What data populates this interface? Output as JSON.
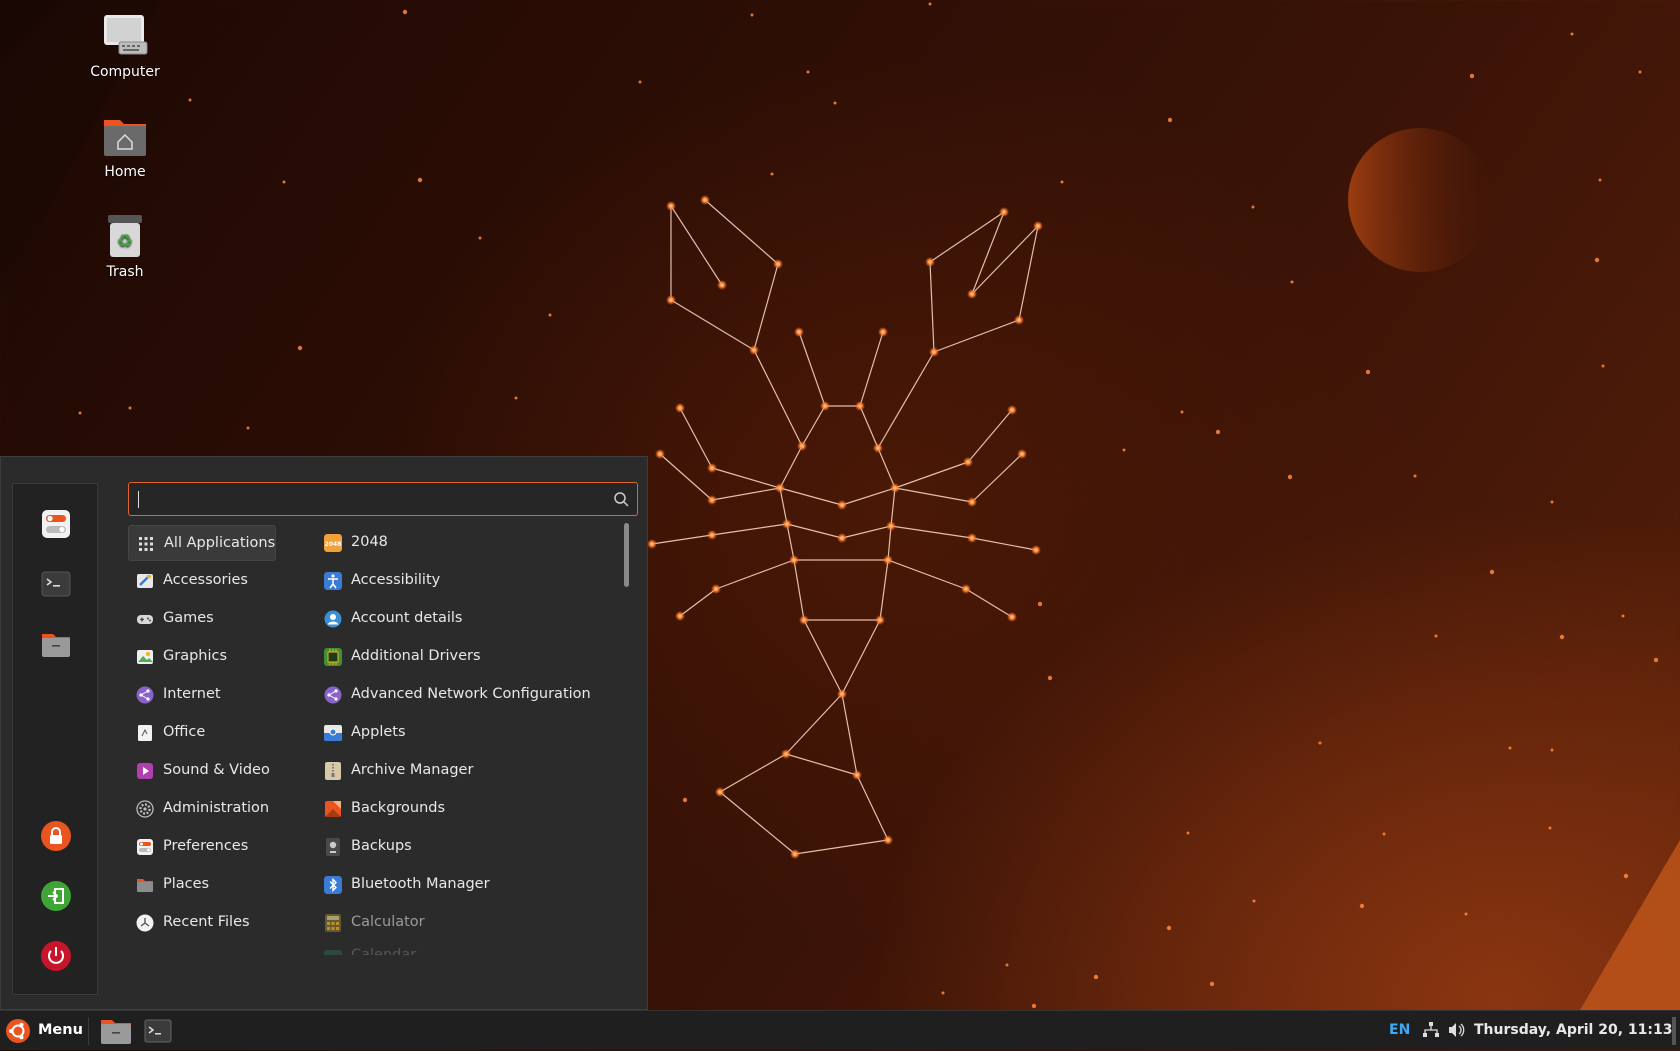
{
  "desktop": {
    "icons": [
      {
        "label": "Computer",
        "icon": "computer-icon"
      },
      {
        "label": "Home",
        "icon": "home-folder-icon"
      },
      {
        "label": "Trash",
        "icon": "trash-icon"
      }
    ]
  },
  "menu": {
    "search": {
      "value": "",
      "placeholder": ""
    },
    "favorites": [
      {
        "icon": "settings-toggle-icon"
      },
      {
        "icon": "terminal-icon"
      },
      {
        "icon": "folder-icon"
      }
    ],
    "session": [
      {
        "icon": "lock-icon",
        "color": "#e95420"
      },
      {
        "icon": "logout-icon",
        "color": "#3fa535"
      },
      {
        "icon": "power-icon",
        "color": "#c7162b"
      }
    ],
    "categories": [
      {
        "label": "All Applications",
        "icon": "grid-icon",
        "active": true
      },
      {
        "label": "Accessories",
        "icon": "accessories-icon"
      },
      {
        "label": "Games",
        "icon": "gamepad-icon"
      },
      {
        "label": "Graphics",
        "icon": "graphics-icon"
      },
      {
        "label": "Internet",
        "icon": "internet-icon"
      },
      {
        "label": "Office",
        "icon": "office-icon"
      },
      {
        "label": "Sound & Video",
        "icon": "media-icon"
      },
      {
        "label": "Administration",
        "icon": "gear-icon"
      },
      {
        "label": "Preferences",
        "icon": "preferences-icon"
      },
      {
        "label": "Places",
        "icon": "places-folder-icon"
      },
      {
        "label": "Recent Files",
        "icon": "recent-clock-icon"
      }
    ],
    "apps": [
      {
        "label": "2048",
        "icon": "game-2048-icon"
      },
      {
        "label": "Accessibility",
        "icon": "accessibility-icon"
      },
      {
        "label": "Account details",
        "icon": "account-icon"
      },
      {
        "label": "Additional Drivers",
        "icon": "chip-icon"
      },
      {
        "label": "Advanced Network Configuration",
        "icon": "network-config-icon"
      },
      {
        "label": "Applets",
        "icon": "applets-icon"
      },
      {
        "label": "Archive Manager",
        "icon": "archive-icon"
      },
      {
        "label": "Backgrounds",
        "icon": "backgrounds-icon"
      },
      {
        "label": "Backups",
        "icon": "backups-icon"
      },
      {
        "label": "Bluetooth Manager",
        "icon": "bluetooth-icon"
      },
      {
        "label": "Calculator",
        "icon": "calculator-icon",
        "dim": true
      },
      {
        "label": "Calendar",
        "icon": "calendar-icon",
        "faded": true
      }
    ]
  },
  "taskbar": {
    "menu_label": "Menu",
    "tasks": [
      {
        "icon": "folder-icon"
      },
      {
        "icon": "terminal-icon"
      }
    ],
    "keyboard_layout": "EN",
    "clock": "Thursday, April 20, 11:13"
  },
  "colors": {
    "accent": "#e95420",
    "menu_bg": "#2b2b2b",
    "taskbar_bg": "#1f1f1f"
  }
}
